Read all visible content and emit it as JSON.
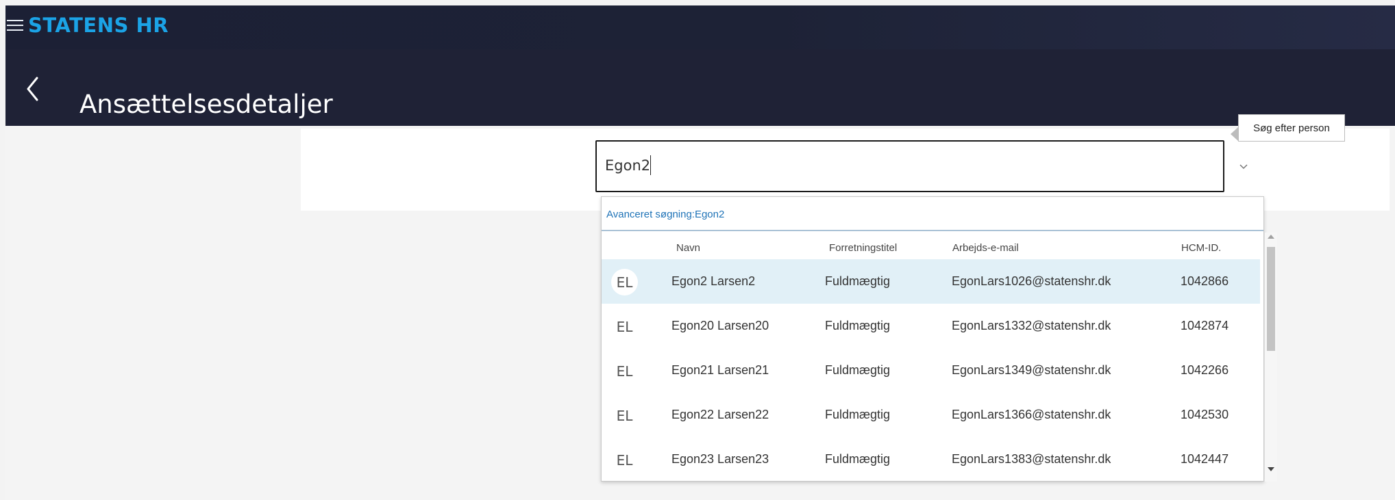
{
  "app": {
    "title": "STATENS HR"
  },
  "header": {
    "page_title": "Ansættelsesdetaljer"
  },
  "search": {
    "value": "Egon2",
    "tooltip": "Søg efter person",
    "advanced_search_label": "Avanceret søgning:Egon2"
  },
  "results": {
    "columns": [
      "Navn",
      "Forretningstitel",
      "Arbejds-e-mail",
      "HCM-ID."
    ],
    "rows": [
      {
        "initials": "EL",
        "name": "Egon2 Larsen2",
        "title": "Fuldmægtig",
        "email": "EgonLars1026@statenshr.dk",
        "hcm_id": "1042866",
        "selected": true
      },
      {
        "initials": "EL",
        "name": "Egon20 Larsen20",
        "title": "Fuldmægtig",
        "email": "EgonLars1332@statenshr.dk",
        "hcm_id": "1042874",
        "selected": false
      },
      {
        "initials": "EL",
        "name": "Egon21 Larsen21",
        "title": "Fuldmægtig",
        "email": "EgonLars1349@statenshr.dk",
        "hcm_id": "1042266",
        "selected": false
      },
      {
        "initials": "EL",
        "name": "Egon22 Larsen22",
        "title": "Fuldmægtig",
        "email": "EgonLars1366@statenshr.dk",
        "hcm_id": "1042530",
        "selected": false
      },
      {
        "initials": "EL",
        "name": "Egon23 Larsen23",
        "title": "Fuldmægtig",
        "email": "EgonLars1383@statenshr.dk",
        "hcm_id": "1042447",
        "selected": false
      }
    ]
  },
  "colors": {
    "brand": "#1ba3e6",
    "header_bg": "#1f2236",
    "selected_row": "#e1f0f7",
    "link": "#1f73b7"
  },
  "icons": {
    "menu": "hamburger-menu-icon",
    "back": "chevron-left-icon",
    "dropdown": "chevron-down-icon",
    "scroll_up": "scroll-up-arrow-icon",
    "scroll_down": "scroll-down-arrow-icon"
  }
}
